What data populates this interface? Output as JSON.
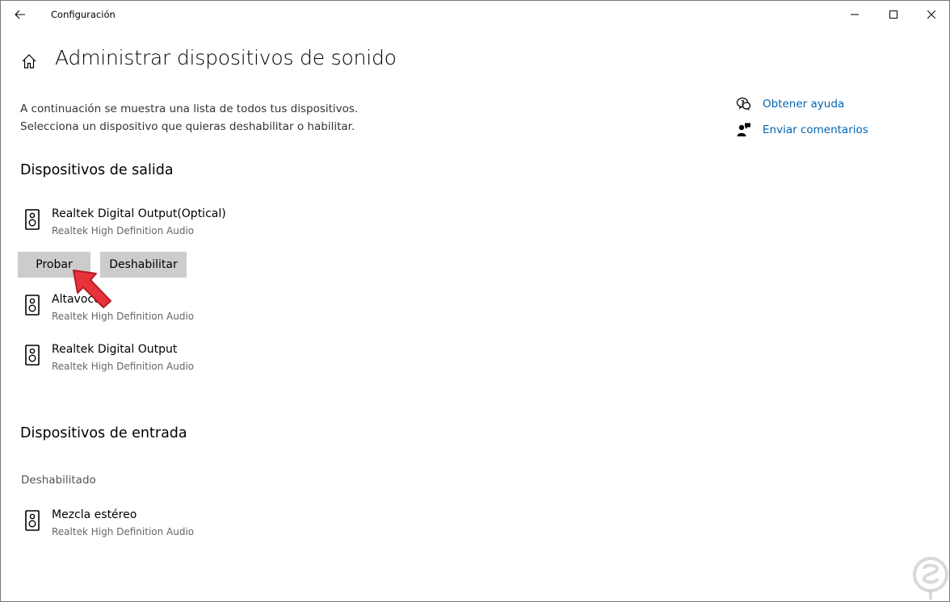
{
  "window": {
    "title": "Configuración"
  },
  "header": {
    "title": "Administrar dispositivos de sonido"
  },
  "description": {
    "line1": "A continuación se muestra una lista de todos tus dispositivos.",
    "line2": "Selecciona un dispositivo que quieras deshabilitar o habilitar."
  },
  "links": {
    "help": "Obtener ayuda",
    "feedback": "Enviar comentarios"
  },
  "output": {
    "heading": "Dispositivos de salida",
    "devices": [
      {
        "name": "Realtek Digital Output(Optical)",
        "driver": "Realtek High Definition Audio"
      },
      {
        "name": "Altavoces",
        "driver": "Realtek High Definition Audio"
      },
      {
        "name": "Realtek Digital Output",
        "driver": "Realtek High Definition Audio"
      }
    ],
    "buttons": {
      "test": "Probar",
      "disable": "Deshabilitar"
    }
  },
  "input": {
    "heading": "Dispositivos de entrada",
    "disabled_label": "Deshabilitado",
    "devices": [
      {
        "name": "Mezcla estéreo",
        "driver": "Realtek High Definition Audio"
      }
    ]
  },
  "colors": {
    "link": "#0063b1",
    "button_bg": "#cccccc",
    "annotation_arrow": "#e8323c"
  }
}
